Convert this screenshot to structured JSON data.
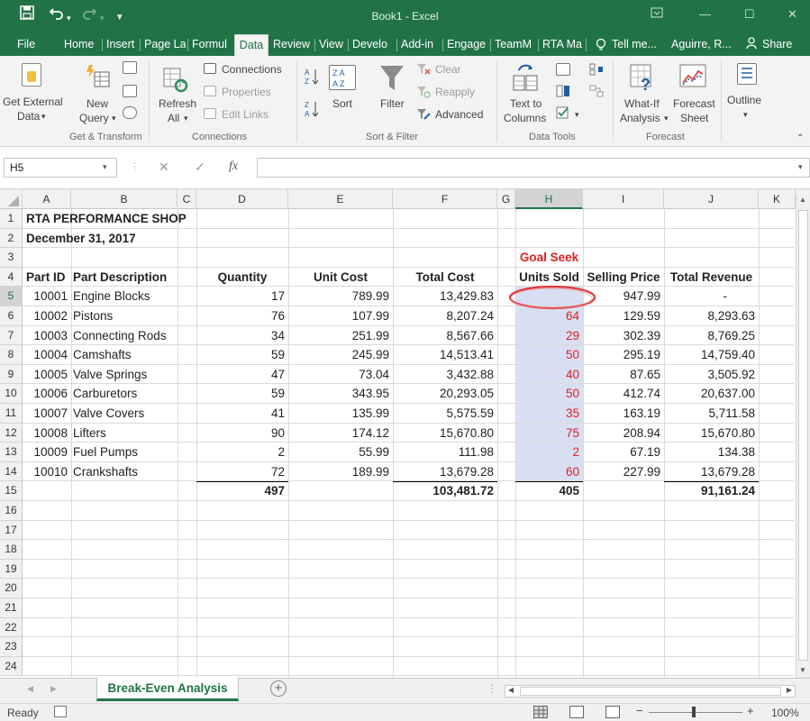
{
  "title_bar": {
    "title": "Book1 - Excel"
  },
  "tabs": [
    "File",
    "Home",
    "Insert",
    "Page La",
    "Formul",
    "Data",
    "Review",
    "View",
    "Develo",
    "Add-in",
    "Engage",
    "TeamM",
    "RTA Ma"
  ],
  "tell_me": "Tell me...",
  "user": "Aguirre, R...",
  "share": "Share",
  "ribbon": {
    "get_external_data": [
      "Get External",
      "Data"
    ],
    "new_query": [
      "New",
      "Query"
    ],
    "refresh_all": [
      "Refresh",
      "All"
    ],
    "connections": "Connections",
    "properties": "Properties",
    "edit_links": "Edit Links",
    "sort": "Sort",
    "filter": "Filter",
    "clear": "Clear",
    "reapply": "Reapply",
    "advanced": "Advanced",
    "text_to_columns": [
      "Text to",
      "Columns"
    ],
    "what_if": [
      "What-If",
      "Analysis"
    ],
    "forecast_sheet": [
      "Forecast",
      "Sheet"
    ],
    "outline": "Outline",
    "groups": [
      "Get & Transform",
      "Connections",
      "Sort & Filter",
      "Data Tools",
      "Forecast"
    ]
  },
  "formula_bar": {
    "name_box": "H5",
    "fx": "fx",
    "formula": ""
  },
  "columns": [
    "A",
    "B",
    "C",
    "D",
    "E",
    "F",
    "G",
    "H",
    "I",
    "J",
    "K"
  ],
  "rows": [
    "1",
    "2",
    "3",
    "4",
    "5",
    "6",
    "7",
    "8",
    "9",
    "10",
    "11",
    "12",
    "13",
    "14",
    "15",
    "16",
    "17",
    "18",
    "19",
    "20",
    "21",
    "22",
    "23",
    "24"
  ],
  "sheet": {
    "title": "RTA PERFORMANCE SHOP",
    "date": "December 31, 2017",
    "goal_seek": "Goal Seek",
    "headers": [
      "Part ID",
      "Part Description",
      "Quantity",
      "Unit Cost",
      "Total Cost",
      "Units Sold",
      "Selling Price",
      "Total Revenue"
    ],
    "data": [
      [
        "10001",
        "Engine Blocks",
        "17",
        "789.99",
        "13,429.83",
        "",
        "947.99",
        "-"
      ],
      [
        "10002",
        "Pistons",
        "76",
        "107.99",
        "8,207.24",
        "64",
        "129.59",
        "8,293.63"
      ],
      [
        "10003",
        "Connecting Rods",
        "34",
        "251.99",
        "8,567.66",
        "29",
        "302.39",
        "8,769.25"
      ],
      [
        "10004",
        "Camshafts",
        "59",
        "245.99",
        "14,513.41",
        "50",
        "295.19",
        "14,759.40"
      ],
      [
        "10005",
        "Valve Springs",
        "47",
        "73.04",
        "3,432.88",
        "40",
        "87.65",
        "3,505.92"
      ],
      [
        "10006",
        "Carburetors",
        "59",
        "343.95",
        "20,293.05",
        "50",
        "412.74",
        "20,637.00"
      ],
      [
        "10007",
        "Valve Covers",
        "41",
        "135.99",
        "5,575.59",
        "35",
        "163.19",
        "5,711.58"
      ],
      [
        "10008",
        "Lifters",
        "90",
        "174.12",
        "15,670.80",
        "75",
        "208.94",
        "15,670.80"
      ],
      [
        "10009",
        "Fuel Pumps",
        "2",
        "55.99",
        "111.98",
        "2",
        "67.19",
        "134.38"
      ],
      [
        "10010",
        "Crankshafts",
        "72",
        "189.99",
        "13,679.28",
        "60",
        "227.99",
        "13,679.28"
      ]
    ],
    "totals": {
      "quantity": "497",
      "total_cost": "103,481.72",
      "units_sold": "405",
      "total_revenue": "91,161.24"
    }
  },
  "sheet_tab": "Break-Even Analysis",
  "status": {
    "ready": "Ready",
    "zoom": "100%"
  },
  "colors": {
    "excel_green": "#217346",
    "goal_seek_red": "#e02020",
    "selection_shade": "#d9dff2"
  }
}
